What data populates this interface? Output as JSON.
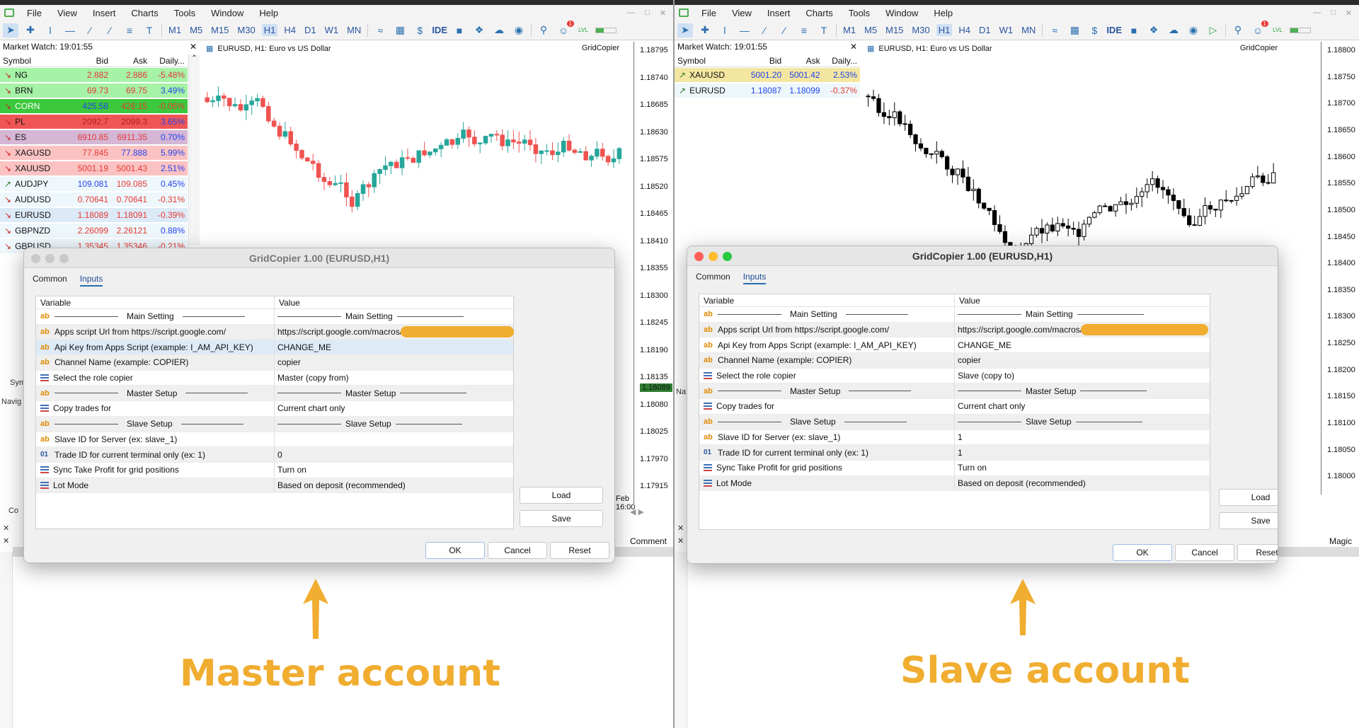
{
  "menu": [
    "File",
    "View",
    "Insert",
    "Charts",
    "Tools",
    "Window",
    "Help"
  ],
  "timeframes": [
    "M1",
    "M5",
    "M15",
    "M30",
    "H1",
    "H4",
    "D1",
    "W1",
    "MN"
  ],
  "toolbar": {
    "ide": "IDE",
    "lvl": "LVL",
    "badge": "1"
  },
  "colors": {
    "accent": "#f0ad30",
    "up": "#26a69a",
    "down": "#ef5350",
    "blue_link": "#2a6fb0"
  },
  "master": {
    "market_watch_title": "Market Watch: 19:01:55",
    "mw_cols": [
      "Symbol",
      "Bid",
      "Ask",
      "Daily..."
    ],
    "symbols": [
      {
        "sym": "NG",
        "bid": "2.882",
        "ask": "2.886",
        "daily": "-5.48%",
        "bg": "#a6f2a6",
        "dir": "down",
        "bidc": "#e53935",
        "askc": "#e53935",
        "dc": "#e53935"
      },
      {
        "sym": "BRN",
        "bid": "69.73",
        "ask": "69.75",
        "daily": "3.49%",
        "bg": "#a6f2a6",
        "dir": "down",
        "bidc": "#e53935",
        "askc": "#e53935",
        "dc": "#2244ee"
      },
      {
        "sym": "CORN",
        "bid": "425.58",
        "ask": "426.15",
        "daily": "-0.06%",
        "bg": "#3cc83c",
        "dir": "down",
        "bidc": "#2244ee",
        "askc": "#e53935",
        "dc": "#e53935",
        "symc": "#fff"
      },
      {
        "sym": "PL",
        "bid": "2092.7",
        "ask": "2099.3",
        "daily": "3.65%",
        "bg": "#f05555",
        "dir": "down",
        "bidc": "#b71c1c",
        "askc": "#b71c1c",
        "dc": "#2244ee"
      },
      {
        "sym": "ES",
        "bid": "6910.85",
        "ask": "6911.35",
        "daily": "0.70%",
        "bg": "#d5b6d5",
        "dir": "down",
        "bidc": "#e53935",
        "askc": "#e53935",
        "dc": "#2244ee"
      },
      {
        "sym": "XAGUSD",
        "bid": "77.845",
        "ask": "77.888",
        "daily": "5.99%",
        "bg": "#fbc2c2",
        "dir": "down",
        "bidc": "#e53935",
        "askc": "#2244ee",
        "dc": "#2244ee"
      },
      {
        "sym": "XAUUSD",
        "bid": "5001.19",
        "ask": "5001.43",
        "daily": "2.51%",
        "bg": "#fbc2c2",
        "dir": "down",
        "bidc": "#e53935",
        "askc": "#e53935",
        "dc": "#2244ee"
      },
      {
        "sym": "AUDJPY",
        "bid": "109.081",
        "ask": "109.085",
        "daily": "0.45%",
        "bg": "#eef7fb",
        "dir": "up",
        "bidc": "#2244ee",
        "askc": "#e53935",
        "dc": "#2244ee"
      },
      {
        "sym": "AUDUSD",
        "bid": "0.70641",
        "ask": "0.70641",
        "daily": "-0.31%",
        "bg": "#eef7fb",
        "dir": "down",
        "bidc": "#e53935",
        "askc": "#e53935",
        "dc": "#e53935"
      },
      {
        "sym": "EURUSD",
        "bid": "1.18089",
        "ask": "1.18091",
        "daily": "-0.39%",
        "bg": "#dceaf7",
        "dir": "down",
        "bidc": "#e53935",
        "askc": "#e53935",
        "dc": "#e53935"
      },
      {
        "sym": "GBPNZD",
        "bid": "2.26099",
        "ask": "2.26121",
        "daily": "0.88%",
        "bg": "#eef7fb",
        "dir": "down",
        "bidc": "#e53935",
        "askc": "#e53935",
        "dc": "#2244ee"
      },
      {
        "sym": "GBPUSD",
        "bid": "1.35345",
        "ask": "1.35346",
        "daily": "-0.21%",
        "bg": "#eef7fb",
        "dir": "down",
        "bidc": "#e53935",
        "askc": "#e53935",
        "dc": "#e53935"
      }
    ],
    "chart_title": "EURUSD, H1:  Euro vs US Dollar",
    "brand": "GridCopier",
    "prices": [
      "1.18795",
      "1.18740",
      "1.18685",
      "1.18630",
      "1.18575",
      "1.18520",
      "1.18465",
      "1.18410",
      "1.18355",
      "1.18300",
      "1.18245",
      "1.18190",
      "1.18135",
      "1.18080",
      "1.18025",
      "1.17970",
      "1.17915"
    ],
    "current_price": "1.18089",
    "date_label": "Feb 16:00",
    "comment": "Comment",
    "dialog_title": "GridCopier 1.00 (EURUSD,H1)",
    "tabs": [
      "Common",
      "Inputs"
    ],
    "grid_headers": [
      "Variable",
      "Value"
    ],
    "rows": [
      {
        "icon": "ab",
        "var": "Main Setting",
        "val": "Main Setting",
        "sep": true
      },
      {
        "icon": "ab",
        "var": "Apps script Url from https://script.google.com/",
        "val": "https://script.google.com/macros/",
        "redact": true
      },
      {
        "icon": "ab",
        "var": "Api Key from Apps Script (example: I_AM_API_KEY)",
        "val": "CHANGE_ME",
        "sel": true
      },
      {
        "icon": "ab",
        "var": "Channel Name (example: COPIER)",
        "val": "copier"
      },
      {
        "icon": "enum",
        "var": "Select the role copier",
        "val": "Master (copy from)"
      },
      {
        "icon": "ab",
        "var": "Master Setup",
        "val": "Master Setup",
        "sep": true
      },
      {
        "icon": "enum",
        "var": "Copy trades for",
        "val": "Current chart only"
      },
      {
        "icon": "ab",
        "var": "Slave Setup",
        "val": "Slave Setup",
        "sep": true
      },
      {
        "icon": "ab",
        "var": "Slave ID for Server (ex: slave_1)",
        "val": ""
      },
      {
        "icon": "01",
        "var": "Trade ID for current terminal only (ex: 1)",
        "val": "0"
      },
      {
        "icon": "enum",
        "var": "Sync Take Profit for grid positions",
        "val": "Turn on"
      },
      {
        "icon": "enum",
        "var": "Lot Mode",
        "val": "Based on deposit (recommended)"
      }
    ],
    "buttons": {
      "load": "Load",
      "save": "Save",
      "ok": "OK",
      "cancel": "Cancel",
      "reset": "Reset"
    },
    "caption": "Master account",
    "side_labels": [
      "Sym",
      "Navig",
      "Co"
    ]
  },
  "slave": {
    "market_watch_title": "Market Watch: 19:01:55",
    "mw_cols": [
      "Symbol",
      "Bid",
      "Ask",
      "Daily..."
    ],
    "symbols": [
      {
        "sym": "XAUUSD",
        "bid": "5001.20",
        "ask": "5001.42",
        "daily": "2.53%",
        "bg": "#f3e6a0",
        "dir": "up",
        "bidc": "#2244ee",
        "askc": "#2244ee",
        "dc": "#2244ee"
      },
      {
        "sym": "EURUSD",
        "bid": "1.18087",
        "ask": "1.18099",
        "daily": "-0.37%",
        "bg": "#eef7fb",
        "dir": "up",
        "bidc": "#2244ee",
        "askc": "#2244ee",
        "dc": "#e53935"
      }
    ],
    "chart_title": "EURUSD, H1:  Euro vs US Dollar",
    "brand": "GridCopier",
    "prices": [
      "1.18800",
      "1.18750",
      "1.18700",
      "1.18650",
      "1.18600",
      "1.18550",
      "1.18500",
      "1.18450",
      "1.18400",
      "1.18350",
      "1.18300",
      "1.18250",
      "1.18200",
      "1.18150",
      "1.18100",
      "1.18050",
      "1.18000"
    ],
    "dialog_title": "GridCopier 1.00 (EURUSD,H1)",
    "tabs": [
      "Common",
      "Inputs"
    ],
    "grid_headers": [
      "Variable",
      "Value"
    ],
    "rows": [
      {
        "icon": "ab",
        "var": "Main Setting",
        "val": "Main Setting",
        "sep": true
      },
      {
        "icon": "ab",
        "var": "Apps script Url from https://script.google.com/",
        "val": "https://script.google.com/macros/",
        "redact": true
      },
      {
        "icon": "ab",
        "var": "Api Key from Apps Script (example: I_AM_API_KEY)",
        "val": "CHANGE_ME"
      },
      {
        "icon": "ab",
        "var": "Channel Name (example: COPIER)",
        "val": "copier"
      },
      {
        "icon": "enum",
        "var": "Select the role copier",
        "val": "Slave (copy to)"
      },
      {
        "icon": "ab",
        "var": "Master Setup",
        "val": "Master Setup",
        "sep": true
      },
      {
        "icon": "enum",
        "var": "Copy trades for",
        "val": "Current chart only"
      },
      {
        "icon": "ab",
        "var": "Slave Setup",
        "val": "Slave Setup",
        "sep": true
      },
      {
        "icon": "ab",
        "var": "Slave ID for Server (ex: slave_1)",
        "val": "1"
      },
      {
        "icon": "01",
        "var": "Trade ID for current terminal only (ex: 1)",
        "val": "1"
      },
      {
        "icon": "enum",
        "var": "Sync Take Profit for grid positions",
        "val": "Turn on"
      },
      {
        "icon": "enum",
        "var": "Lot Mode",
        "val": "Based on deposit (recommended)"
      }
    ],
    "buttons": {
      "load": "Load",
      "save": "Save",
      "ok": "OK",
      "cancel": "Cancel",
      "reset": "Reset"
    },
    "caption": "Slave account",
    "magic": "Magic",
    "nav_label": "Na"
  }
}
